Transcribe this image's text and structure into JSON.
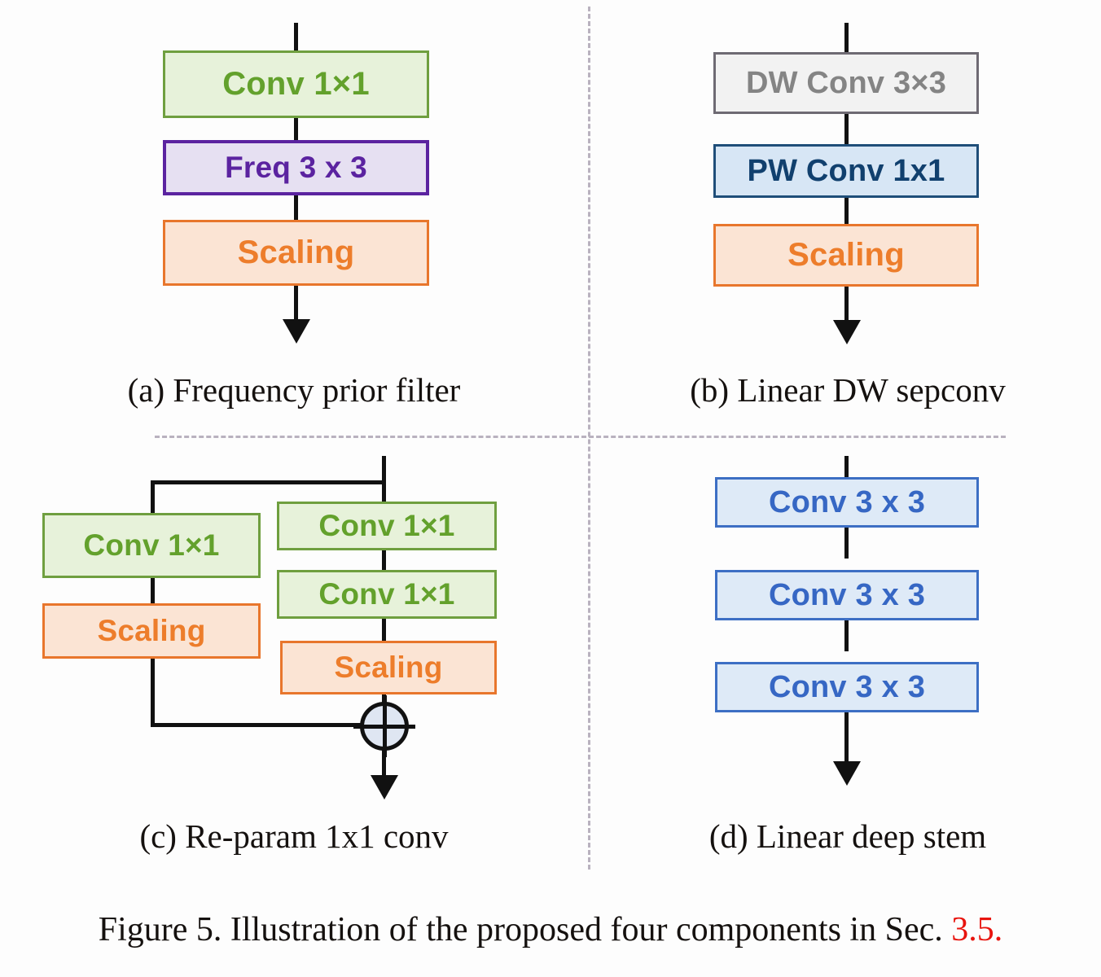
{
  "figure": {
    "caption_prefix": "Figure 5. Illustration of the proposed four components in Sec.",
    "caption_section_ref": "3.5.",
    "section_ref_color": "#e8140e"
  },
  "palette": {
    "green_fill": "#e7f2da",
    "green_border": "#6f9f3f",
    "green_text": "#63a12c",
    "purple_fill": "#e6e0f2",
    "purple_border": "#5b23a0",
    "purple_text": "#5b23a0",
    "orange_fill": "#fbe4d4",
    "orange_border": "#e8762c",
    "orange_text": "#ed7d2b",
    "gray_fill": "#f2f2f2",
    "gray_border": "#6e6a73",
    "gray_text": "#848484",
    "blue_dark_fill": "#d7e6f5",
    "blue_dark_border": "#1f4e79",
    "blue_dark_text": "#11406e",
    "blue_bright_fill": "#deeaf7",
    "blue_bright_border": "#3d6fc4",
    "blue_bright_text": "#3667c4",
    "connector": "#111111",
    "divider": "#b9b2bf",
    "plus_fill": "#dfe6f2"
  },
  "panels": [
    {
      "id": "a",
      "caption": "(a) Frequency prior filter",
      "blocks": [
        {
          "label": "Conv 1×1",
          "style": "green"
        },
        {
          "label": "Freq 3 x 3",
          "style": "purple"
        },
        {
          "label": "Scaling",
          "style": "orange"
        }
      ]
    },
    {
      "id": "b",
      "caption": "(b) Linear DW sepconv",
      "blocks": [
        {
          "label": "DW Conv 3×3",
          "style": "gray"
        },
        {
          "label": "PW Conv 1x1",
          "style": "bluedark"
        },
        {
          "label": "Scaling",
          "style": "orange"
        }
      ]
    },
    {
      "id": "c",
      "caption": "(c) Re-param 1x1 conv",
      "left_branch": [
        {
          "label": "Conv 1×1",
          "style": "green"
        },
        {
          "label": "Scaling",
          "style": "orange"
        }
      ],
      "right_branch": [
        {
          "label": "Conv 1×1",
          "style": "green"
        },
        {
          "label": "Conv 1×1",
          "style": "green"
        },
        {
          "label": "Scaling",
          "style": "orange"
        }
      ],
      "merge_symbol": "⊕"
    },
    {
      "id": "d",
      "caption": "(d) Linear deep stem",
      "blocks": [
        {
          "label": "Conv 3 x 3",
          "style": "bluebright"
        },
        {
          "label": "Conv 3 x 3",
          "style": "bluebright"
        },
        {
          "label": "Conv 3 x 3",
          "style": "bluebright"
        }
      ]
    }
  ]
}
